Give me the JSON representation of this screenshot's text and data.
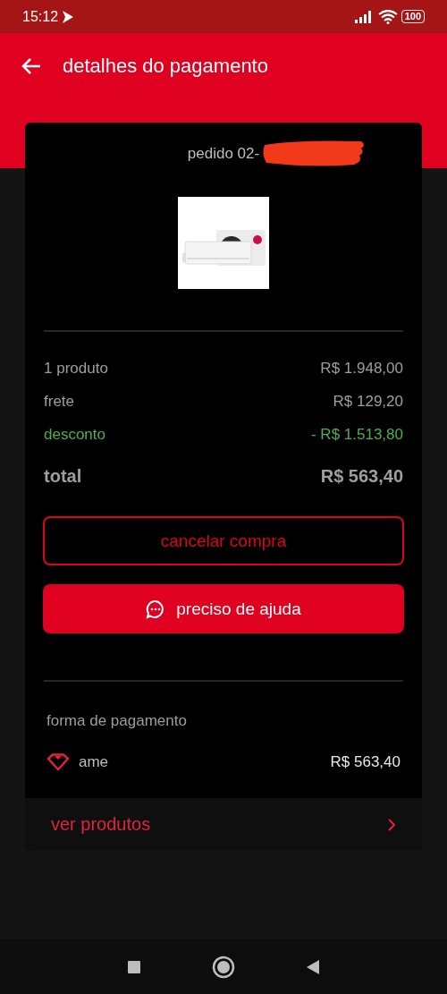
{
  "status_bar": {
    "time": "15:12",
    "battery": "100"
  },
  "header": {
    "title": "detalhes do pagamento"
  },
  "order": {
    "label": "pedido 02-",
    "redacted": true
  },
  "summary": [
    {
      "kind": "normal",
      "label": "1 produto",
      "value": "R$ 1.948,00"
    },
    {
      "kind": "normal",
      "label": "frete",
      "value": "R$ 129,20"
    },
    {
      "kind": "discount",
      "label": "desconto",
      "value": "- R$ 1.513,80"
    },
    {
      "kind": "total",
      "label": "total",
      "value": "R$ 563,40"
    }
  ],
  "buttons": [
    {
      "kind": "outline",
      "label": "cancelar compra"
    },
    {
      "kind": "filled",
      "label": "preciso de ajuda"
    }
  ],
  "payment": {
    "heading": "forma de pagamento",
    "method": "ame",
    "amount": "R$ 563,40"
  },
  "footer_link": {
    "label": "ver produtos"
  }
}
